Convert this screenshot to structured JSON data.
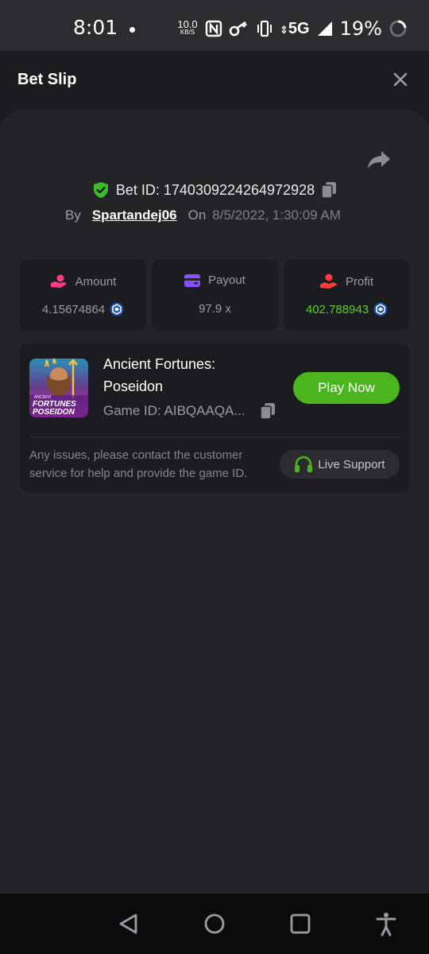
{
  "status_bar": {
    "time": "8:01",
    "speed_value": "10.0",
    "speed_unit": "KB/S",
    "network": "5G",
    "battery": "19%"
  },
  "header": {
    "title": "Bet Slip"
  },
  "bet": {
    "id_text": "Bet ID: 1740309224264972928",
    "by_label": "By",
    "user": "Spartandej06",
    "on_label": "On",
    "date": "8/5/2022, 1:30:09 AM"
  },
  "stats": {
    "amount_label": "Amount",
    "amount_value": "4.15674864",
    "payout_label": "Payout",
    "payout_value": "97.9 x",
    "profit_label": "Profit",
    "profit_value": "402.788943"
  },
  "game": {
    "title": "Ancient Fortunes: Poseidon",
    "thumb_text_top": "ANCIENT",
    "thumb_text_mid": "FORTUNES",
    "thumb_text_bottom": "POSEIDON",
    "game_id": "Game ID: AIBQAAQA...",
    "play_label": "Play Now",
    "help_text": "Any issues, please contact the customer service for help and provide the game ID.",
    "support_label": "Live Support"
  },
  "colors": {
    "accent_green": "#4bb51d",
    "profit_green": "#5fd12e",
    "amount_pink": "#ff3d7f",
    "payout_purple": "#8a4dff",
    "profit_red": "#ff3b3b",
    "coin_blue": "#1a4fa8"
  },
  "icons": {
    "shield": "shield-check-icon",
    "copy": "copy-icon",
    "share": "share-icon",
    "close": "close-icon",
    "coin": "crypto-coin-icon",
    "headset": "headset-icon"
  }
}
